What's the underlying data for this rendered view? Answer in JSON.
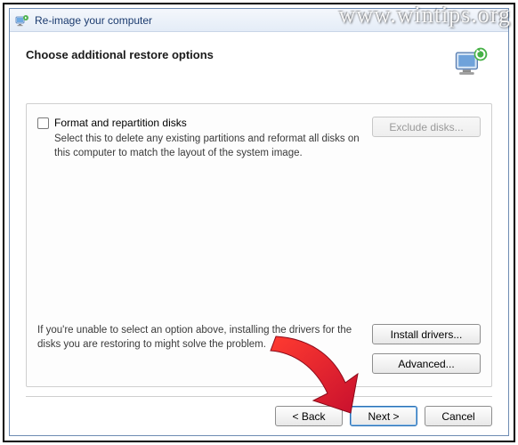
{
  "window": {
    "title": "Re-image your computer"
  },
  "page": {
    "heading": "Choose additional restore options"
  },
  "format_option": {
    "label": "Format and repartition disks",
    "help": "Select this to delete any existing partitions and reformat all disks on this computer to match the layout of the system image.",
    "checked": false
  },
  "buttons": {
    "exclude_disks": "Exclude disks...",
    "install_drivers": "Install drivers...",
    "advanced": "Advanced...",
    "back": "< Back",
    "next": "Next >",
    "cancel": "Cancel"
  },
  "driver_hint": "If you're unable to select an option above, installing the drivers for the disks you are restoring to might solve the problem.",
  "watermark": "www.wintips.org"
}
